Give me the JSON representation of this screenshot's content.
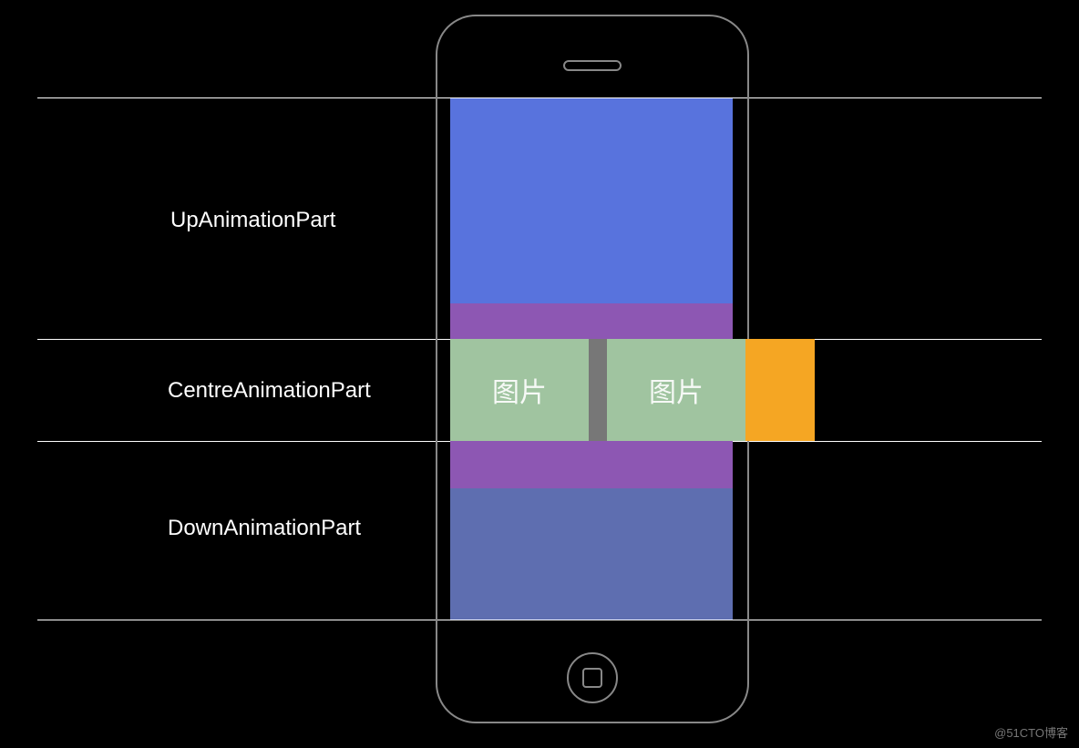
{
  "labels": {
    "up": "UpAnimationPart",
    "centre": "CentreAnimationPart",
    "down": "DownAnimationPart"
  },
  "images": {
    "label1": "图片",
    "label2": "图片"
  },
  "watermark": "@51CTO博客",
  "colors": {
    "top_blue": "#5873dd",
    "purple": "#8d57b3",
    "orange": "#f5a623",
    "image_green": "#a0c4a0",
    "gap_gray": "#777777",
    "bottom_blue": "#5e6eb0",
    "outline": "#888888",
    "guideline": "#ffffff",
    "background": "#000000"
  }
}
